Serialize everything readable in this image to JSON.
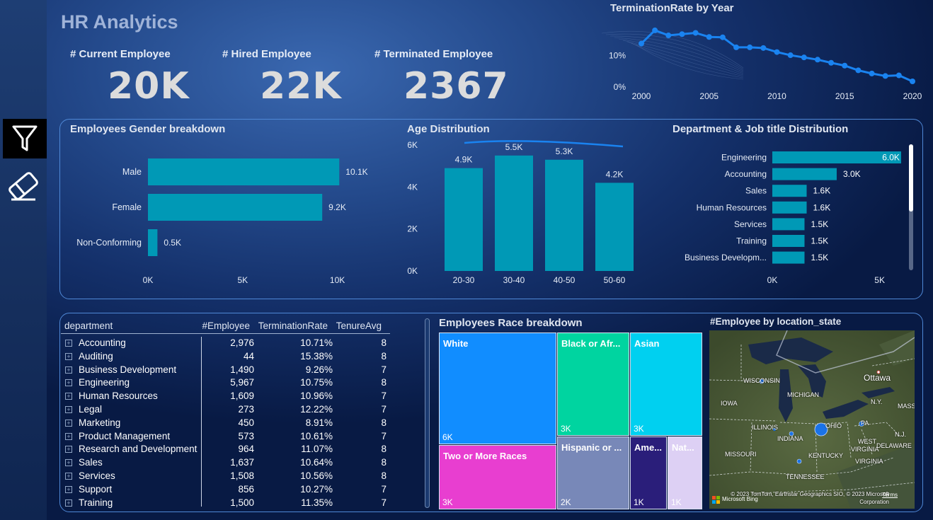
{
  "title": "HR Analytics",
  "sidebar": {
    "tools": [
      {
        "icon": "filter-icon"
      },
      {
        "icon": "eraser-icon"
      }
    ]
  },
  "kpis": [
    {
      "label": "# Current Employee",
      "value": "20K"
    },
    {
      "label": "# Hired Employee",
      "value": "22K"
    },
    {
      "label": "# Terminated Employee",
      "value": "2367"
    }
  ],
  "colors": {
    "bar": "#0099b6",
    "line": "#1a83f0",
    "panel_border": "#4f88d6"
  },
  "termination_chart": {
    "title": "TerminationRate by Year",
    "chart_data": {
      "type": "line",
      "x": [
        2000,
        2001,
        2002,
        2003,
        2004,
        2005,
        2006,
        2007,
        2008,
        2009,
        2010,
        2011,
        2012,
        2013,
        2014,
        2015,
        2016,
        2017,
        2018,
        2019,
        2020
      ],
      "values": [
        13.8,
        18.0,
        16.4,
        16.8,
        17.2,
        15.9,
        15.8,
        12.6,
        12.6,
        12.4,
        11.1,
        10.1,
        9.4,
        8.7,
        7.7,
        6.8,
        5.3,
        4.3,
        3.5,
        3.7,
        1.8
      ],
      "xticks": [
        "2000",
        "2005",
        "2010",
        "2015",
        "2020"
      ],
      "yticks": [
        "10%",
        "0%"
      ],
      "ylim": [
        0,
        20
      ],
      "xlim": [
        2000,
        2020
      ]
    }
  },
  "gender_chart": {
    "title": "Employees Gender breakdown",
    "chart_data": {
      "type": "bar",
      "orientation": "horizontal",
      "categories": [
        "Male",
        "Female",
        "Non-Conforming"
      ],
      "values": [
        10.1,
        9.2,
        0.5
      ],
      "labels": [
        "10.1K",
        "9.2K",
        "0.5K"
      ],
      "xticks": [
        "0K",
        "5K",
        "10K"
      ],
      "xlim": [
        0,
        10.8
      ]
    }
  },
  "age_chart": {
    "title": "Age Distribution",
    "chart_data": {
      "type": "bar",
      "categories": [
        "20-30",
        "30-40",
        "40-50",
        "50-60"
      ],
      "values": [
        4.9,
        5.5,
        5.3,
        4.2
      ],
      "labels": [
        "4.9K",
        "5.5K",
        "5.3K",
        "4.2K"
      ],
      "yticks": [
        "6K",
        "4K",
        "2K",
        "0K"
      ],
      "ylim": [
        0,
        6
      ]
    }
  },
  "dept_chart": {
    "title": "Department & Job title Distribution",
    "chart_data": {
      "type": "bar",
      "orientation": "horizontal",
      "categories": [
        "Engineering",
        "Accounting",
        "Sales",
        "Human Resources",
        "Services",
        "Training",
        "Business Developm..."
      ],
      "values": [
        6.0,
        3.0,
        1.6,
        1.6,
        1.5,
        1.5,
        1.5
      ],
      "labels": [
        "6.0K",
        "3.0K",
        "1.6K",
        "1.6K",
        "1.5K",
        "1.5K",
        "1.5K"
      ],
      "xticks": [
        "0K",
        "5K"
      ],
      "xlim": [
        0,
        6.2
      ]
    }
  },
  "table": {
    "headers": [
      "department",
      "#Employee",
      "TerminationRate",
      "TenureAvg"
    ],
    "expand_glyph": "+",
    "rows": [
      {
        "dept": "Accounting",
        "emp": "2,976",
        "term": "10.71%",
        "tenure": "8"
      },
      {
        "dept": "Auditing",
        "emp": "44",
        "term": "15.38%",
        "tenure": "8"
      },
      {
        "dept": "Business Development",
        "emp": "1,490",
        "term": "9.26%",
        "tenure": "7"
      },
      {
        "dept": "Engineering",
        "emp": "5,967",
        "term": "10.75%",
        "tenure": "8"
      },
      {
        "dept": "Human Resources",
        "emp": "1,609",
        "term": "10.96%",
        "tenure": "7"
      },
      {
        "dept": "Legal",
        "emp": "273",
        "term": "12.22%",
        "tenure": "7"
      },
      {
        "dept": "Marketing",
        "emp": "450",
        "term": "8.91%",
        "tenure": "8"
      },
      {
        "dept": "Product Management",
        "emp": "573",
        "term": "10.61%",
        "tenure": "7"
      },
      {
        "dept": "Research and Development",
        "emp": "964",
        "term": "11.07%",
        "tenure": "8"
      },
      {
        "dept": "Sales",
        "emp": "1,637",
        "term": "10.64%",
        "tenure": "8"
      },
      {
        "dept": "Services",
        "emp": "1,508",
        "term": "10.56%",
        "tenure": "8"
      },
      {
        "dept": "Support",
        "emp": "856",
        "term": "10.27%",
        "tenure": "7"
      },
      {
        "dept": "Training",
        "emp": "1,500",
        "term": "11.35%",
        "tenure": "7"
      }
    ]
  },
  "race_chart": {
    "title": "Employees Race breakdown",
    "chart_data": {
      "type": "treemap",
      "items": [
        {
          "label": "White",
          "value": "6K",
          "color": "#118dff"
        },
        {
          "label": "Black or Afr...",
          "value": "3K",
          "color": "#00d4a0"
        },
        {
          "label": "Asian",
          "value": "3K",
          "color": "#00d0f0"
        },
        {
          "label": "Two or More Races",
          "value": "3K",
          "color": "#e83ed0"
        },
        {
          "label": "Hispanic or ...",
          "value": "2K",
          "color": "#7888b8"
        },
        {
          "label": "Ame...",
          "value": "1K",
          "color": "#2a1e7a"
        },
        {
          "label": "Nat...",
          "value": "1K",
          "color": "#ddd0f4"
        }
      ]
    }
  },
  "map": {
    "title": "#Employee by location_state",
    "labels": [
      "WISCONSIN",
      "MICHIGAN",
      "Ottawa",
      "IOWA",
      "N.Y.",
      "MASS.",
      "ILLINOIS",
      "OHIO",
      "PA",
      "N.J.",
      "INDIANA",
      "WEST",
      "VIRGINIA",
      "DELAWARE",
      "MISSOURI",
      "KENTUCKY",
      "VIRGINIA",
      "TENNESSEE"
    ],
    "copyright": "© 2023 TomTom, Earthstar Geographics SIO, © 2023 Microsoft Corporation",
    "brand": "Microsoft Bing",
    "terms": "Terms"
  }
}
